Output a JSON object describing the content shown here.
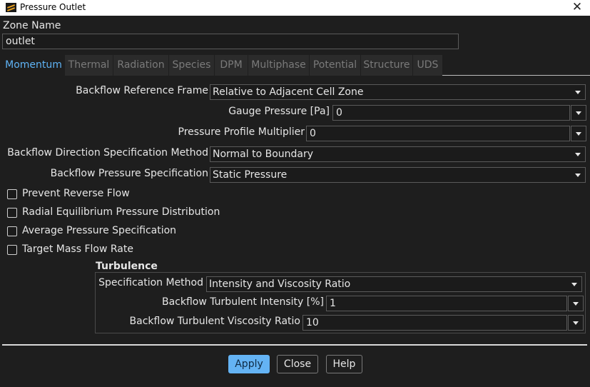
{
  "window": {
    "title": "Pressure Outlet"
  },
  "zone": {
    "label": "Zone Name",
    "value": "outlet"
  },
  "tabs": [
    "Momentum",
    "Thermal",
    "Radiation",
    "Species",
    "DPM",
    "Multiphase",
    "Potential",
    "Structure",
    "UDS"
  ],
  "momentum": {
    "backflow_reference_frame": {
      "label": "Backflow Reference Frame",
      "value": "Relative to Adjacent Cell Zone"
    },
    "gauge_pressure": {
      "label": "Gauge Pressure  [Pa]",
      "value": "0"
    },
    "pressure_profile_multiplier": {
      "label": "Pressure Profile Multiplier",
      "value": "0"
    },
    "backflow_direction_method": {
      "label": "Backflow Direction Specification Method",
      "value": "Normal to Boundary"
    },
    "backflow_pressure_spec": {
      "label": "Backflow Pressure Specification",
      "value": "Static Pressure"
    },
    "checkboxes": [
      {
        "label": "Prevent Reverse Flow",
        "checked": false
      },
      {
        "label": "Radial Equilibrium Pressure Distribution",
        "checked": false
      },
      {
        "label": "Average Pressure Specification",
        "checked": false
      },
      {
        "label": "Target Mass Flow Rate",
        "checked": false
      }
    ]
  },
  "turbulence": {
    "title": "Turbulence",
    "specification_method": {
      "label": "Specification Method",
      "value": "Intensity and Viscosity Ratio"
    },
    "intensity": {
      "label": "Backflow Turbulent Intensity [%]",
      "value": "1"
    },
    "viscosity_ratio": {
      "label": "Backflow Turbulent Viscosity Ratio",
      "value": "10"
    }
  },
  "buttons": {
    "apply": "Apply",
    "close": "Close",
    "help": "Help"
  },
  "colors": {
    "accent": "#64b3f4",
    "active_tab": "#5fb3f5",
    "background": "#1e1e1e"
  }
}
